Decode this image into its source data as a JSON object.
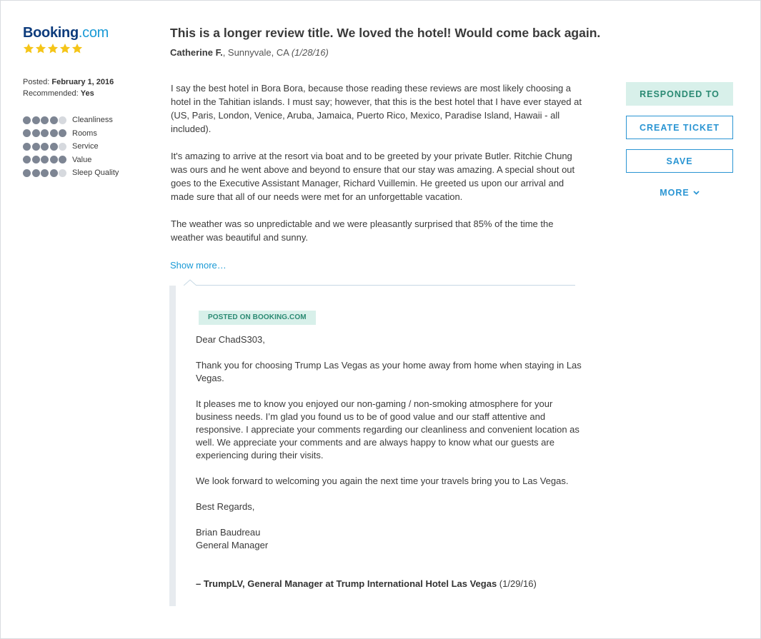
{
  "brand": {
    "name_part1": "Booking",
    "name_part2": ".com",
    "star_color": "#f5c518",
    "primary_color": "#0c3b7c",
    "accent_color": "#1a9ad6"
  },
  "review": {
    "stars": 5,
    "posted_label": "Posted:",
    "posted_date": "February 1, 2016",
    "recommended_label": "Recommended:",
    "recommended_value": "Yes",
    "ratings": [
      {
        "label": "Cleanliness",
        "score": 4,
        "max": 5
      },
      {
        "label": "Rooms",
        "score": 5,
        "max": 5
      },
      {
        "label": "Service",
        "score": 4,
        "max": 5
      },
      {
        "label": "Value",
        "score": 5,
        "max": 5
      },
      {
        "label": "Sleep Quality",
        "score": 4,
        "max": 5
      }
    ],
    "title": "This is a longer review title. We loved the hotel! Would come back again.",
    "author": "Catherine F.",
    "location": ", Sunnyvale, CA",
    "date": "(1/28/16)",
    "paragraphs": [
      "I say the best hotel in Bora Bora, because those reading these reviews are most likely choosing a hotel in the Tahitian islands. I must say; however, that this is the best hotel that I have ever stayed at (US, Paris, London, Venice, Aruba, Jamaica, Puerto Rico, Mexico, Paradise Island, Hawaii - all included).",
      "It's amazing to arrive at the resort via boat and to be greeted by your private Butler. Ritchie Chung was ours and he went above and beyond to ensure that our stay was amazing. A special shout out goes to the Executive Assistant Manager, Richard Vuillemin. He greeted us upon our arrival and made sure that all of our needs were met for an unforgettable vacation.",
      "The weather was so unpredictable and we were pleasantly surprised that 85% of the time the weather was beautiful and sunny."
    ],
    "show_more": "Show more…"
  },
  "response": {
    "badge": "POSTED ON BOOKING.COM",
    "paragraphs": [
      "Dear ChadS303,",
      "Thank you for choosing Trump Las Vegas as your home away from home when staying in Las Vegas.",
      "It pleases me to know you enjoyed our non-gaming / non-smoking atmosphere for your business needs. I’m glad you found us to be of good value and our staff attentive and responsive. I appreciate your comments regarding our cleanliness and convenient location as well. We appreciate your comments and are always happy to know what our guests are experiencing during their visits.",
      "We look forward to welcoming you again the next time your travels bring you to Las Vegas.",
      "Best Regards,"
    ],
    "signer_name": "Brian Baudreau",
    "signer_title": "General Manager",
    "signature": "– TrumpLV, General Manager at Trump International Hotel Las Vegas",
    "signature_date": " (1/29/16)"
  },
  "actions": {
    "responded": "RESPONDED TO",
    "create_ticket": "CREATE TICKET",
    "save": "SAVE",
    "more": "MORE"
  }
}
